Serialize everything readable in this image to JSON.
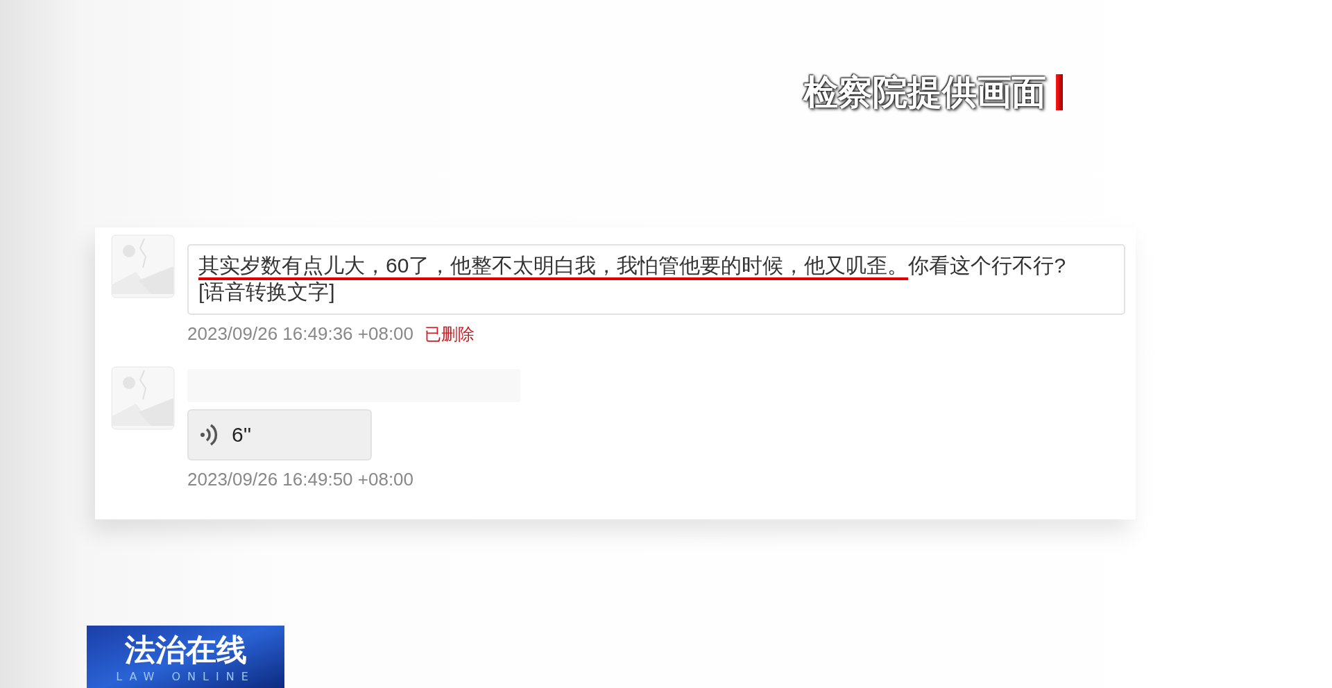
{
  "caption": "检察院提供画面",
  "messages": [
    {
      "kind": "text",
      "segments": [
        {
          "text": "其实岁数有点儿大，60了，他整不太明白我，我怕管他要的时候，他又叽歪。",
          "underlined": true
        },
        {
          "text": "你看这个行不行?",
          "underlined": false
        }
      ],
      "note": "[语音转换文字]",
      "time": "2023/09/26 16:49:36 +08:00",
      "status": "已删除",
      "redacted_name": false
    },
    {
      "kind": "voice",
      "duration": "6''",
      "time": "2023/09/26 16:49:50 +08:00",
      "redacted_name": true
    }
  ],
  "program_logo": {
    "title": "法治在线",
    "subtitle": "LAW ONLINE"
  }
}
